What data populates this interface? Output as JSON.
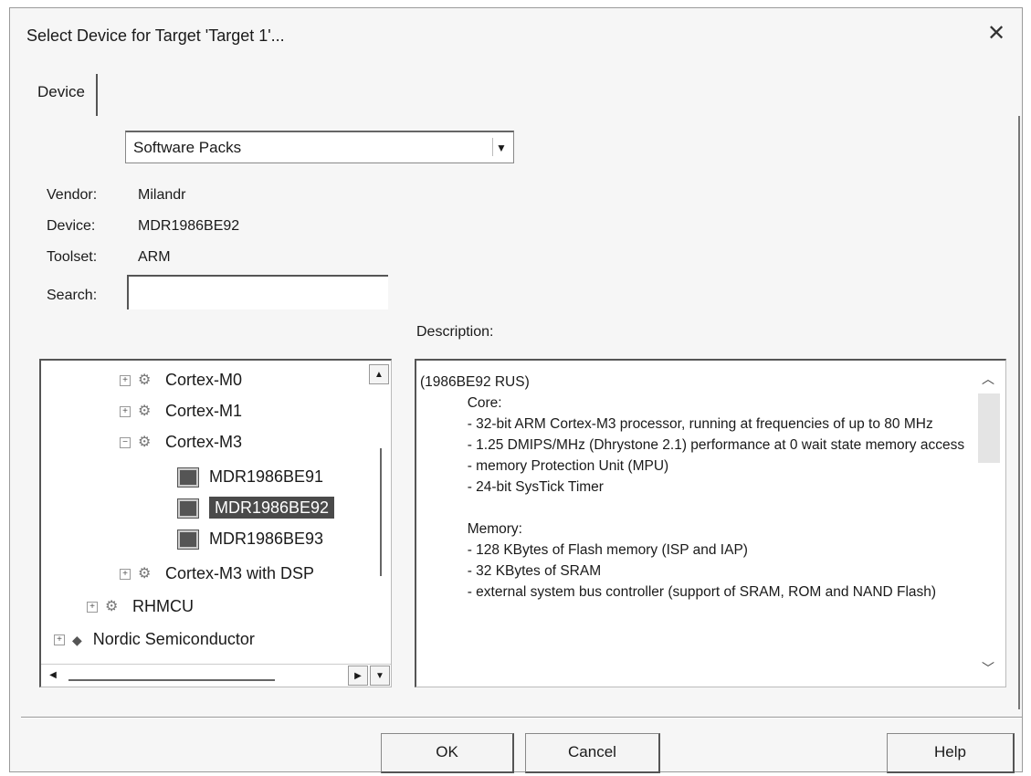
{
  "window": {
    "title": "Select Device for Target 'Target 1'..."
  },
  "tabs": [
    {
      "label": "Device"
    }
  ],
  "source_select": {
    "value": "Software Packs"
  },
  "info": {
    "vendor_label": "Vendor:",
    "vendor_value": "Milandr",
    "device_label": "Device:",
    "device_value": "MDR1986BE92",
    "toolset_label": "Toolset:",
    "toolset_value": "ARM",
    "search_label": "Search:",
    "search_value": ""
  },
  "description": {
    "label": "Description:",
    "text": "(1986BE92 RUS)\n            Core:\n            - 32-bit ARM Cortex-M3 processor, running at frequencies of up to 80 MHz\n            - 1.25 DMIPS/MHz (Dhrystone 2.1) performance at 0 wait state memory access\n            - memory Protection Unit (MPU)\n            - 24-bit SysTick Timer\n\n            Memory:\n            - 128 KBytes of Flash memory (ISP and IAP)\n            - 32 KBytes of SRAM\n            - external system bus controller (support of SRAM, ROM and NAND Flash)"
  },
  "tree": {
    "items": [
      {
        "label": "Cortex-M0",
        "expander": "+"
      },
      {
        "label": "Cortex-M1",
        "expander": "+"
      },
      {
        "label": "Cortex-M3",
        "expander": "−"
      },
      {
        "label": "MDR1986BE91"
      },
      {
        "label": "MDR1986BE92",
        "selected": true
      },
      {
        "label": "MDR1986BE93"
      },
      {
        "label": "Cortex-M3 with DSP",
        "expander": "+"
      },
      {
        "label": "RHMCU",
        "expander": "+"
      },
      {
        "label": "Nordic Semiconductor",
        "expander": "+"
      }
    ]
  },
  "buttons": {
    "ok": "OK",
    "cancel": "Cancel",
    "help": "Help"
  },
  "icons": {
    "close": "close-icon",
    "dropdown": "chevron-down-icon",
    "family": "cpu-family-icon",
    "device": "chip-icon",
    "vendor": "vendor-diamond-icon"
  },
  "colors": {
    "selection": "#4a4a4a",
    "selection_text": "#ffffff"
  }
}
